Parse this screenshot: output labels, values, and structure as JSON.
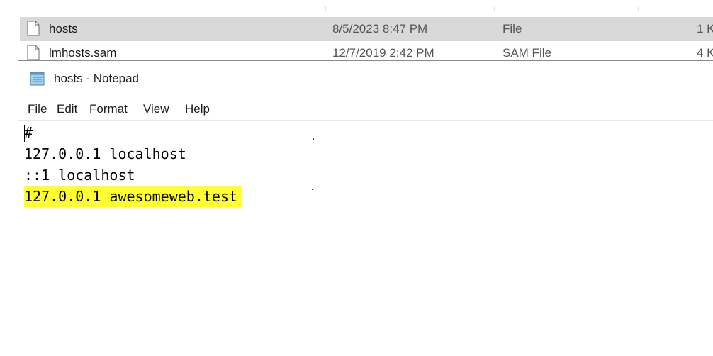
{
  "explorer": {
    "files": [
      {
        "name": "hosts",
        "date_modified": "8/5/2023 8:47 PM",
        "type": "File",
        "size": "1 K",
        "selected": true,
        "icon": "file-icon"
      },
      {
        "name": "lmhosts.sam",
        "date_modified": "12/7/2019 2:42 PM",
        "type": "SAM File",
        "size": "4 K",
        "selected": false,
        "icon": "file-icon"
      }
    ]
  },
  "notepad": {
    "title": "hosts - Notepad",
    "icon": "notepad-icon",
    "menu": [
      "File",
      "Edit",
      "Format",
      "View",
      "Help"
    ],
    "lines": [
      "#",
      "127.0.0.1 localhost",
      "::1 localhost",
      "127.0.0.1 awesomeweb.test"
    ],
    "highlighted_line_index": 3,
    "highlight_color": "#ffff33"
  },
  "colors": {
    "selected_row_background": "#d9d9d9",
    "window_border": "#8a8a8a"
  }
}
